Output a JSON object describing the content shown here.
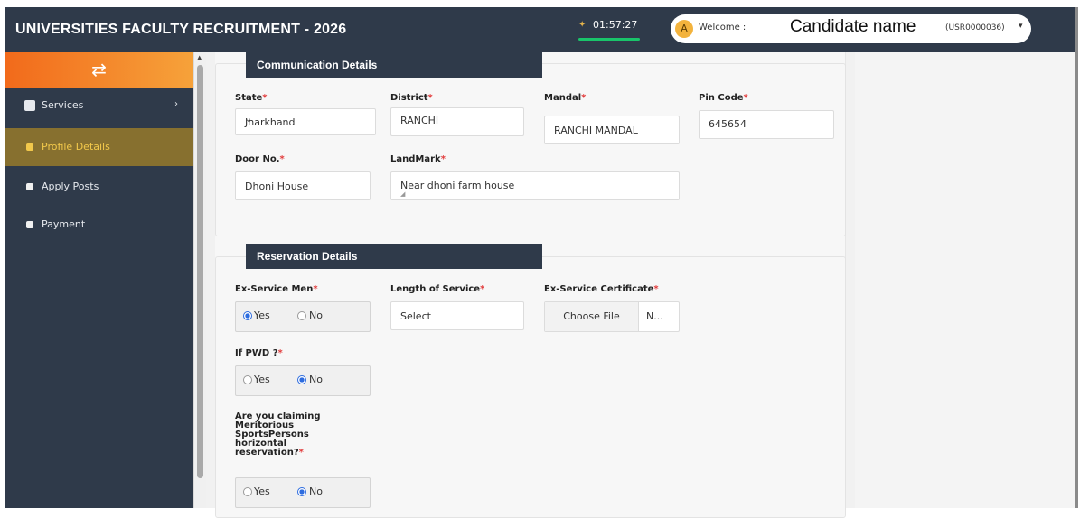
{
  "app": {
    "title": "UNIVERSITIES FACULTY RECRUITMENT - 2026",
    "timer": "01:57:27",
    "avatar_letter": "A",
    "welcome": "Welcome :",
    "candidate_name": "Candidate name",
    "user_id": "(USR0000036)",
    "caret": "▾"
  },
  "sidebar": {
    "toggle_icon": "⇄",
    "items": [
      {
        "label": "Services",
        "icon": "grid-icon",
        "chevron": "›"
      },
      {
        "label": "Profile Details",
        "icon": "bullet-icon",
        "active": true
      },
      {
        "label": "Apply Posts",
        "icon": "bullet-icon"
      },
      {
        "label": "Payment",
        "icon": "bullet-icon"
      }
    ]
  },
  "communication": {
    "heading": "Communication Details",
    "state_label": "State",
    "state_value": "Jharkhand",
    "district_label": "District",
    "district_value": "RANCHI",
    "mandal_label": "Mandal",
    "mandal_value": "RANCHI MANDAL",
    "pincode_label": "Pin Code",
    "pincode_value": "645654",
    "door_label": "Door No.",
    "door_value": "Dhoni House",
    "landmark_label": "LandMark",
    "landmark_value": "Near dhoni farm house"
  },
  "reservation": {
    "heading": "Reservation Details",
    "exservice_label": "Ex-Service Men",
    "yes": "Yes",
    "no": "No",
    "exservice_selected": "Yes",
    "length_label": "Length of Service",
    "length_value": "Select",
    "certificate_label": "Ex-Service Certificate",
    "choose_file": "Choose File",
    "file_name": "N...",
    "pwd_label": "If PWD ?",
    "pwd_selected": "No",
    "sports_label_lines": [
      "Are you claiming",
      "Meritorious",
      "SportsPersons",
      "horizontal",
      "reservation?"
    ],
    "sports_selected": "No"
  },
  "required_mark": "*",
  "colors": {
    "header_bg": "#2f3a4a",
    "accent_orange": "#f26a1b",
    "active_nav_bg": "#87702f",
    "required_red": "#e23c3c",
    "radio_blue": "#2d6cdf",
    "timer_green": "#19c46a"
  }
}
